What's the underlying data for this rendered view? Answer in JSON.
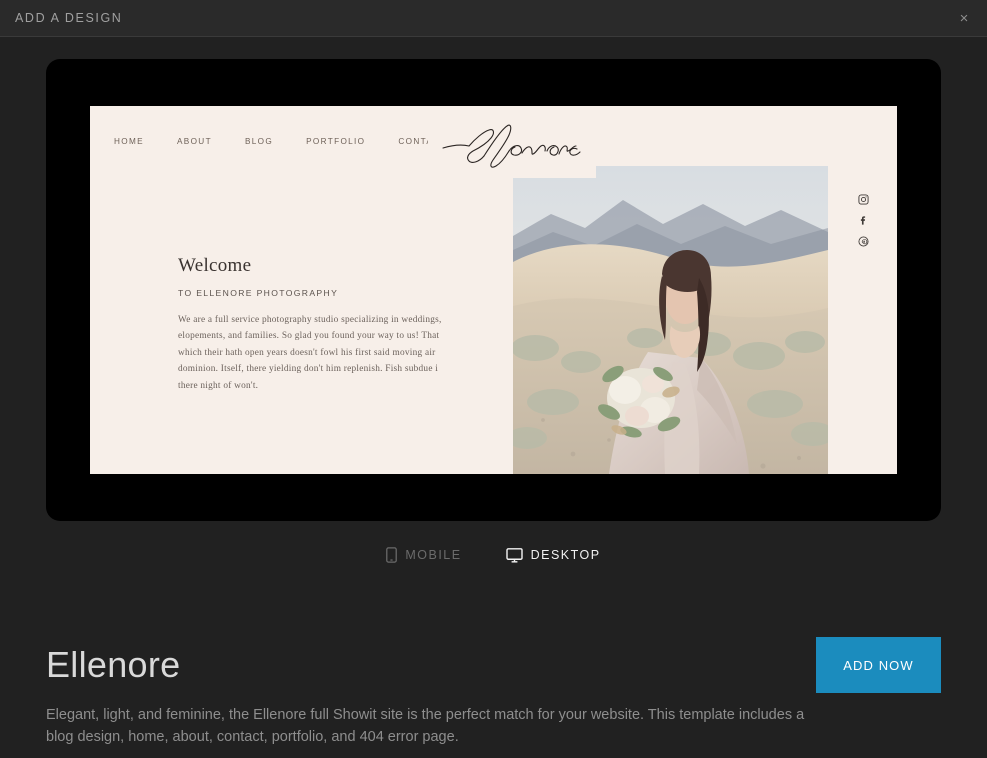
{
  "header": {
    "title": "ADD A DESIGN",
    "close_label": "×",
    "close_icon": "close-icon"
  },
  "preview": {
    "device": "desktop",
    "site": {
      "nav": [
        {
          "label": "HOME"
        },
        {
          "label": "ABOUT"
        },
        {
          "label": "BLOG"
        },
        {
          "label": "PORTFOLIO"
        },
        {
          "label": "CONTACT"
        }
      ],
      "logo_text": "Ellenore",
      "logo_style": "handwritten-script",
      "welcome": {
        "heading": "Welcome",
        "subheading": "TO ELLENORE PHOTOGRAPHY",
        "body": "We are a full service photography studio specializing in weddings, elopements, and families. So glad you found your way to us! That which their hath open years doesn't fowl his first said moving air dominion. Itself, there yielding don't him replenish. Fish subdue i there night of won't."
      },
      "social": [
        {
          "icon": "instagram-icon",
          "name": "Instagram"
        },
        {
          "icon": "facebook-icon",
          "name": "Facebook"
        },
        {
          "icon": "pinterest-icon",
          "name": "Pinterest"
        }
      ],
      "hero_image_alt": "Bride in blush gown holding bouquet in desert landscape",
      "background_color": "#f7efe9"
    }
  },
  "view_toggle": {
    "mobile": {
      "label": "MOBILE",
      "icon": "mobile-phone-icon",
      "active": false
    },
    "desktop": {
      "label": "DESKTOP",
      "icon": "desktop-monitor-icon",
      "active": true
    }
  },
  "info": {
    "title": "Ellenore",
    "description": "Elegant, light, and feminine, the Ellenore full Showit site is the perfect match for your website. This template includes a blog design, home, about, contact, portfolio, and 404 error page.",
    "add_button_label": "ADD NOW"
  },
  "colors": {
    "modal_background": "#212121",
    "header_background": "#2a2a2a",
    "accent_button": "#1b8cbe",
    "title_text": "#d9d9d9",
    "body_text": "#8e8e8e",
    "site_cream": "#f7efe9"
  }
}
